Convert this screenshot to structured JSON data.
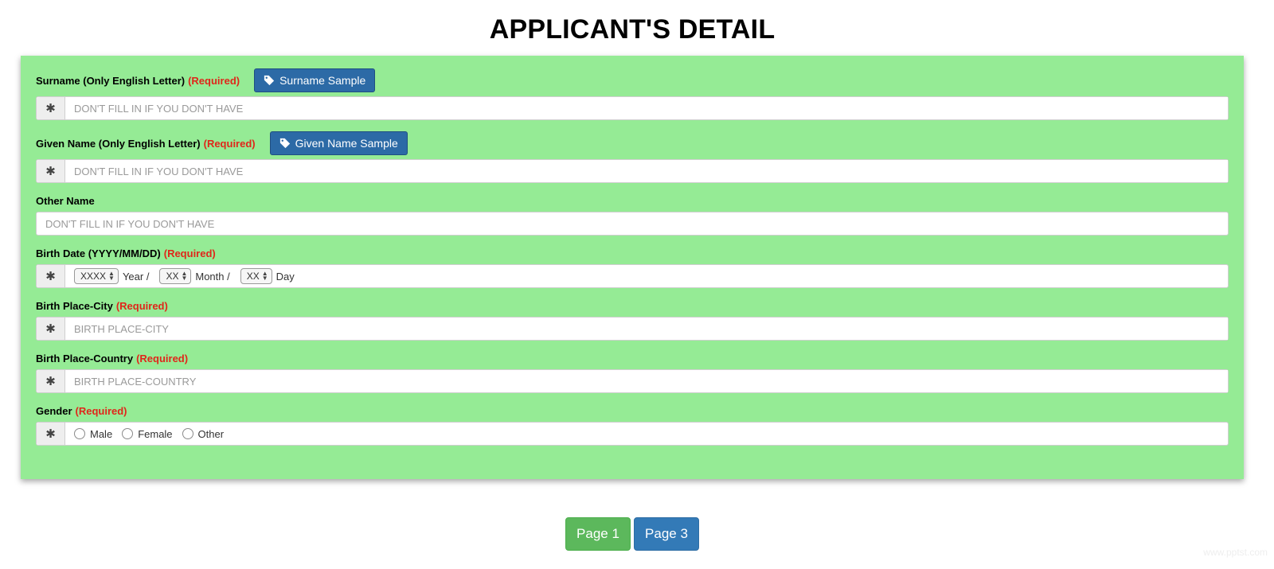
{
  "page_title": "APPLICANT'S DETAIL",
  "required_text": "(Required)",
  "addon_symbol": "✱",
  "surname": {
    "label": "Surname (Only English Letter)",
    "sample_button": "Surname Sample",
    "placeholder": "DON'T FILL IN IF YOU DON'T HAVE"
  },
  "given_name": {
    "label": "Given Name (Only English Letter)",
    "sample_button": "Given Name Sample",
    "placeholder": "DON'T FILL IN IF YOU DON'T HAVE"
  },
  "other_name": {
    "label": "Other Name",
    "placeholder": "DON'T FILL IN IF YOU DON'T HAVE"
  },
  "birth_date": {
    "label": "Birth Date (YYYY/MM/DD)",
    "year_select": "XXXX",
    "year_unit": "Year /",
    "month_select": "XX",
    "month_unit": "Month /",
    "day_select": "XX",
    "day_unit": "Day"
  },
  "birth_city": {
    "label": "Birth Place-City",
    "placeholder": "BIRTH PLACE-CITY"
  },
  "birth_country": {
    "label": "Birth Place-Country",
    "placeholder": "BIRTH PLACE-COUNTRY"
  },
  "gender": {
    "label": "Gender",
    "options": [
      "Male",
      "Female",
      "Other"
    ]
  },
  "pager": {
    "prev": "Page 1",
    "next": "Page 3"
  },
  "colors": {
    "panel": "#95eb95",
    "sample_button": "#2c6aa6",
    "required": "#e0261a",
    "page_prev": "#5cb85c",
    "page_next": "#337ab7"
  },
  "watermark": "www.pptst.com"
}
